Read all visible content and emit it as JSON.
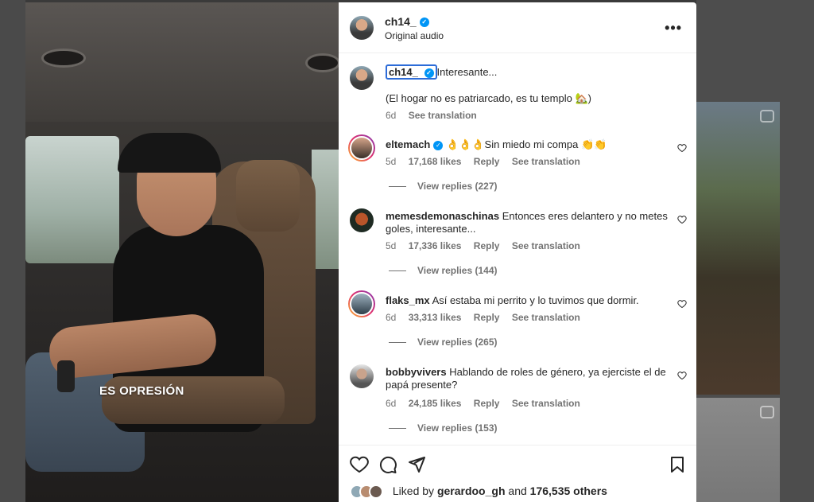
{
  "video": {
    "caption": "ES OPRESIÓN"
  },
  "header": {
    "username": "ch14_",
    "subtitle": "Original audio",
    "more_label": "•••"
  },
  "post": {
    "mention": "ch14_",
    "text_line1": "Interesante...",
    "text_line2": "(El hogar no es patriarcado, es tu templo 🏡)",
    "age": "6d",
    "see_translation": "See translation"
  },
  "comments": [
    {
      "username": "eltemach",
      "verified": true,
      "text": "👌👌👌Sin miedo mi compa 👏👏",
      "age": "5d",
      "likes": "17,168 likes",
      "reply": "Reply",
      "see_translation": "See translation",
      "view_replies": "View replies (227)"
    },
    {
      "username": "memesdemonaschinas",
      "verified": false,
      "text": "Entonces eres delantero y no metes goles, interesante...",
      "age": "5d",
      "likes": "17,336 likes",
      "reply": "Reply",
      "see_translation": "See translation",
      "view_replies": "View replies (144)"
    },
    {
      "username": "flaks_mx",
      "verified": false,
      "text": "Así estaba mi perrito y lo tuvimos que dormir.",
      "age": "6d",
      "likes": "33,313 likes",
      "reply": "Reply",
      "see_translation": "See translation",
      "view_replies": "View replies (265)"
    },
    {
      "username": "bobbyvivers",
      "verified": false,
      "text": "Hablando de roles de género, ya ejerciste el de papá presente?",
      "age": "6d",
      "likes": "24,185 likes",
      "reply": "Reply",
      "see_translation": "See translation",
      "view_replies": "View replies (153)"
    }
  ],
  "footer": {
    "liked_prefix": "Liked by",
    "liked_user": "gerardoo_gh",
    "liked_and": "and",
    "liked_others": "176,535 others"
  },
  "colors": {
    "verified": "#0095f6",
    "text": "#262626",
    "muted": "#737373",
    "focus_outline": "#2d6cd8"
  }
}
